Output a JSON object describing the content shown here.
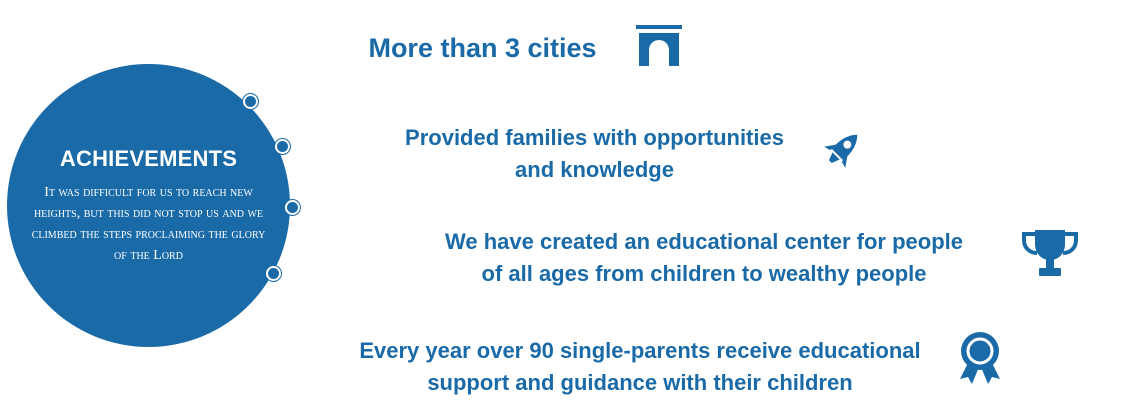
{
  "intro": {
    "title": "ACHIEVEMENTS",
    "body": "It was difficult for us to reach new heights, but this did not stop us and we climbed the steps proclaiming the glory of the Lord"
  },
  "achievements": [
    {
      "text": "More than 3 cities",
      "icon": "gate-icon"
    },
    {
      "line1": "Provided families with opportunities",
      "line2": "and knowledge",
      "icon": "rocket-icon"
    },
    {
      "line1": "We have created an educational center for people",
      "line2": "of all ages from children to wealthy people",
      "icon": "trophy-icon"
    },
    {
      "line1": "Every year over 90 single-parents receive educational",
      "line2": "support and guidance with their children",
      "icon": "award-ribbon-icon"
    }
  ],
  "colors": {
    "accent": "#1a6aa8",
    "background": "#ffffff",
    "text_on_accent": "#ffffff"
  }
}
